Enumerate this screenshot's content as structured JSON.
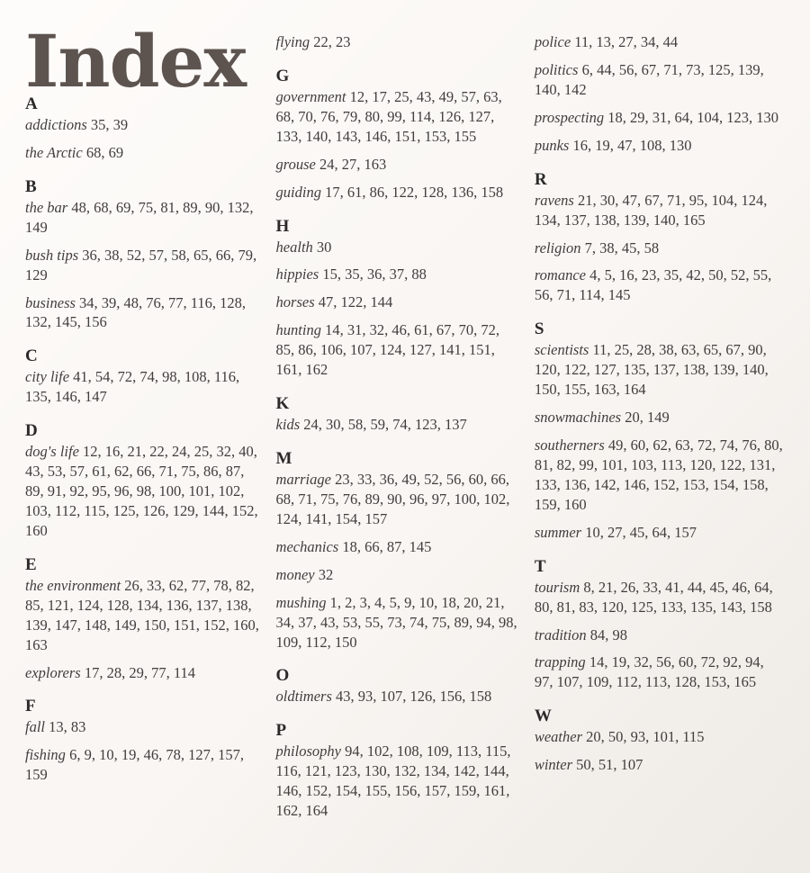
{
  "page": {
    "title": "Index",
    "background_color": "#f9f6f3",
    "title_color": "#5d5450",
    "text_color": "#403d3c"
  },
  "columns": [
    {
      "id": "column-1",
      "blocks": [
        {
          "letter": "A",
          "entries": [
            {
              "term": "addictions",
              "pages": "35, 39"
            },
            {
              "term": "the Arctic",
              "pages": "68, 69"
            }
          ]
        },
        {
          "letter": "B",
          "entries": [
            {
              "term": "the bar",
              "pages": "48, 68, 69, 75, 81, 89, 90, 132, 149"
            },
            {
              "term": "bush tips",
              "pages": "36, 38, 52, 57, 58, 65, 66, 79, 129"
            },
            {
              "term": "business",
              "pages": "34, 39, 48, 76, 77, 116, 128, 132, 145, 156"
            }
          ]
        },
        {
          "letter": "C",
          "entries": [
            {
              "term": "city life",
              "pages": "41, 54, 72, 74, 98, 108, 116, 135, 146, 147"
            }
          ]
        },
        {
          "letter": "D",
          "entries": [
            {
              "term": "dog's life",
              "pages": "12, 16, 21, 22, 24, 25, 32, 40, 43, 53, 57, 61, 62, 66, 71, 75, 86, 87, 89, 91, 92, 95, 96, 98, 100, 101, 102, 103, 112, 115, 125, 126, 129, 144, 152, 160"
            }
          ]
        },
        {
          "letter": "E",
          "entries": [
            {
              "term": "the environment",
              "pages": "26, 33, 62, 77, 78, 82, 85, 121, 124, 128, 134, 136, 137, 138, 139, 147, 148, 149, 150, 151, 152, 160, 163"
            },
            {
              "term": "explorers",
              "pages": "17, 28, 29, 77, 114"
            }
          ]
        },
        {
          "letter": "F",
          "entries": [
            {
              "term": "fall",
              "pages": "13, 83"
            },
            {
              "term": "fishing",
              "pages": "6, 9, 10, 19, 46, 78, 127, 157, 159"
            }
          ]
        }
      ]
    },
    {
      "id": "column-2",
      "blocks": [
        {
          "letter": "",
          "entries": [
            {
              "term": "flying",
              "pages": "22, 23"
            }
          ]
        },
        {
          "letter": "G",
          "entries": [
            {
              "term": "government",
              "pages": "12, 17, 25, 43, 49, 57, 63, 68, 70, 76, 79, 80, 99, 114, 126, 127, 133, 140, 143, 146, 151, 153, 155"
            },
            {
              "term": "grouse",
              "pages": "24, 27, 163"
            },
            {
              "term": "guiding",
              "pages": " 17, 61, 86, 122, 128, 136, 158"
            }
          ]
        },
        {
          "letter": "H",
          "entries": [
            {
              "term": "health",
              "pages": "30"
            },
            {
              "term": "hippies",
              "pages": "15, 35, 36, 37, 88"
            },
            {
              "term": "horses",
              "pages": "47, 122, 144"
            },
            {
              "term": "hunting",
              "pages": "14, 31, 32, 46, 61, 67, 70, 72, 85, 86, 106, 107, 124, 127, 141, 151, 161, 162"
            }
          ]
        },
        {
          "letter": "K",
          "entries": [
            {
              "term": "kids",
              "pages": "24, 30, 58, 59, 74, 123, 137"
            }
          ]
        },
        {
          "letter": "M",
          "entries": [
            {
              "term": "marriage",
              "pages": "23, 33, 36, 49, 52, 56, 60, 66, 68, 71, 75, 76, 89, 90, 96, 97, 100, 102, 124, 141, 154, 157"
            },
            {
              "term": "mechanics",
              "pages": "18, 66, 87, 145"
            },
            {
              "term": "money",
              "pages": "32"
            },
            {
              "term": "mushing",
              "pages": "1, 2, 3, 4, 5, 9, 10, 18, 20, 21, 34, 37, 43, 53, 55, 73, 74, 75, 89, 94, 98, 109, 112, 150"
            }
          ]
        },
        {
          "letter": "O",
          "entries": [
            {
              "term": "oldtimers",
              "pages": "43, 93, 107, 126, 156, 158"
            }
          ]
        },
        {
          "letter": "P",
          "entries": [
            {
              "term": "philosophy",
              "pages": "94, 102, 108, 109, 113, 115, 116, 121, 123, 130, 132, 134, 142, 144, 146, 152, 154, 155, 156, 157, 159, 161, 162, 164"
            }
          ]
        }
      ]
    },
    {
      "id": "column-3",
      "blocks": [
        {
          "letter": "",
          "entries": [
            {
              "term": "police",
              "pages": "11, 13, 27, 34, 44"
            },
            {
              "term": "politics",
              "pages": "6, 44, 56, 67, 71, 73, 125, 139, 140, 142"
            },
            {
              "term": "prospecting",
              "pages": "18, 29, 31, 64, 104, 123, 130"
            },
            {
              "term": "punks",
              "pages": "16, 19, 47, 108, 130"
            }
          ]
        },
        {
          "letter": "R",
          "entries": [
            {
              "term": "ravens",
              "pages": "21, 30, 47, 67, 71, 95, 104, 124, 134, 137, 138, 139, 140, 165"
            },
            {
              "term": "religion",
              "pages": "7, 38, 45, 58"
            },
            {
              "term": "romance",
              "pages": "4, 5, 16, 23, 35, 42, 50, 52, 55, 56, 71, 114, 145"
            }
          ]
        },
        {
          "letter": "S",
          "entries": [
            {
              "term": "scientists",
              "pages": "11, 25, 28, 38, 63, 65, 67, 90, 120, 122, 127, 135, 137, 138, 139, 140, 150, 155, 163, 164"
            },
            {
              "term": "snowmachines",
              "pages": "20, 149"
            },
            {
              "term": "southerners",
              "pages": "49, 60, 62, 63, 72, 74, 76, 80, 81, 82, 99, 101, 103, 113, 120, 122, 131, 133, 136, 142, 146, 152, 153, 154, 158, 159, 160"
            },
            {
              "term": "summer",
              "pages": "10, 27, 45, 64, 157"
            }
          ]
        },
        {
          "letter": "T",
          "entries": [
            {
              "term": "tourism",
              "pages": "8, 21, 26, 33, 41, 44, 45, 46, 64, 80, 81, 83, 120, 125, 133, 135, 143, 158"
            },
            {
              "term": "tradition",
              "pages": "84, 98"
            },
            {
              "term": "trapping",
              "pages": "14, 19, 32, 56, 60, 72, 92, 94, 97, 107, 109, 112, 113, 128, 153, 165"
            }
          ]
        },
        {
          "letter": "W",
          "entries": [
            {
              "term": "weather",
              "pages": "20, 50, 93, 101, 115"
            },
            {
              "term": "winter",
              "pages": "50, 51, 107"
            }
          ]
        }
      ]
    }
  ]
}
